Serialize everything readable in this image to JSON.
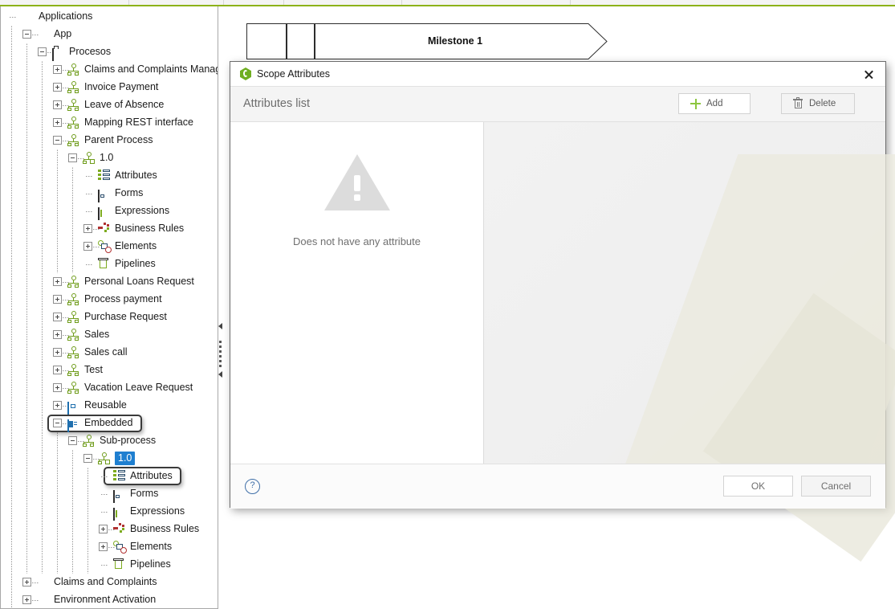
{
  "tree": {
    "panel_name": "applications-tree",
    "items": [
      {
        "label": "Applications",
        "depth": 0,
        "icon": "hexagon-dark-icon",
        "toggle": "none"
      },
      {
        "label": "App",
        "depth": 1,
        "icon": "hexagon-dark-icon",
        "toggle": "minus"
      },
      {
        "label": "Procesos",
        "depth": 2,
        "icon": "folder-icon",
        "toggle": "minus"
      },
      {
        "label": "Claims and Complaints Management",
        "depth": 3,
        "icon": "process-icon",
        "toggle": "plus"
      },
      {
        "label": "Invoice Payment",
        "depth": 3,
        "icon": "process-icon",
        "toggle": "plus"
      },
      {
        "label": "Leave of Absence",
        "depth": 3,
        "icon": "process-icon",
        "toggle": "plus"
      },
      {
        "label": "Mapping REST interface",
        "depth": 3,
        "icon": "process-icon",
        "toggle": "plus"
      },
      {
        "label": "Parent Process",
        "depth": 3,
        "icon": "process-icon",
        "toggle": "minus"
      },
      {
        "label": "1.0",
        "depth": 4,
        "icon": "process-version-icon",
        "toggle": "minus"
      },
      {
        "label": "Attributes",
        "depth": 5,
        "icon": "attributes-icon",
        "toggle": "none"
      },
      {
        "label": "Forms",
        "depth": 5,
        "icon": "forms-icon",
        "toggle": "none"
      },
      {
        "label": "Expressions",
        "depth": 5,
        "icon": "expressions-icon",
        "toggle": "none"
      },
      {
        "label": "Business Rules",
        "depth": 5,
        "icon": "business-rules-icon",
        "toggle": "plus"
      },
      {
        "label": "Elements",
        "depth": 5,
        "icon": "elements-icon",
        "toggle": "plus"
      },
      {
        "label": "Pipelines",
        "depth": 5,
        "icon": "pipelines-icon",
        "toggle": "none"
      },
      {
        "label": "Personal Loans Request",
        "depth": 3,
        "icon": "process-icon",
        "toggle": "plus"
      },
      {
        "label": "Process payment",
        "depth": 3,
        "icon": "process-icon",
        "toggle": "plus"
      },
      {
        "label": "Purchase Request",
        "depth": 3,
        "icon": "process-icon",
        "toggle": "plus"
      },
      {
        "label": "Sales",
        "depth": 3,
        "icon": "process-icon",
        "toggle": "plus"
      },
      {
        "label": "Sales call",
        "depth": 3,
        "icon": "process-icon",
        "toggle": "plus"
      },
      {
        "label": "Test",
        "depth": 3,
        "icon": "process-icon",
        "toggle": "plus"
      },
      {
        "label": "Vacation Leave Request",
        "depth": 3,
        "icon": "process-icon",
        "toggle": "plus"
      },
      {
        "label": "Reusable",
        "depth": 3,
        "icon": "reusable-icon",
        "toggle": "plus"
      },
      {
        "label": "Embedded",
        "depth": 3,
        "icon": "embedded-icon",
        "toggle": "minus",
        "focused": true
      },
      {
        "label": "Sub-process",
        "depth": 4,
        "icon": "process-icon",
        "toggle": "minus"
      },
      {
        "label": "1.0",
        "depth": 5,
        "icon": "process-version-icon",
        "toggle": "minus",
        "selected": true
      },
      {
        "label": "Attributes",
        "depth": 6,
        "icon": "attributes-icon",
        "toggle": "none",
        "focused": true
      },
      {
        "label": "Forms",
        "depth": 6,
        "icon": "forms-icon",
        "toggle": "none"
      },
      {
        "label": "Expressions",
        "depth": 6,
        "icon": "expressions-icon",
        "toggle": "none"
      },
      {
        "label": "Business Rules",
        "depth": 6,
        "icon": "business-rules-icon",
        "toggle": "plus"
      },
      {
        "label": "Elements",
        "depth": 6,
        "icon": "elements-icon",
        "toggle": "plus"
      },
      {
        "label": "Pipelines",
        "depth": 6,
        "icon": "pipelines-icon",
        "toggle": "none"
      },
      {
        "label": "Claims and Complaints",
        "depth": 1,
        "icon": "hexagon-dark-icon",
        "toggle": "plus"
      },
      {
        "label": "Environment Activation",
        "depth": 1,
        "icon": "hexagon-dark-icon",
        "toggle": "plus"
      }
    ]
  },
  "canvas": {
    "milestone_label": "Milestone 1"
  },
  "dialog": {
    "title": "Scope Attributes",
    "close_label": "×",
    "toolbar": {
      "section_title": "Attributes list",
      "add_label": "Add",
      "delete_label": "Delete"
    },
    "empty_state": {
      "message": "Does not have any attribute"
    },
    "footer": {
      "help_label": "?",
      "ok_label": "OK",
      "cancel_label": "Cancel"
    }
  },
  "colors": {
    "accent_green": "#8cb21a",
    "selection_blue": "#1f7fd0",
    "add_plus_green": "#8cc63f",
    "help_blue": "#3f6fa8"
  }
}
